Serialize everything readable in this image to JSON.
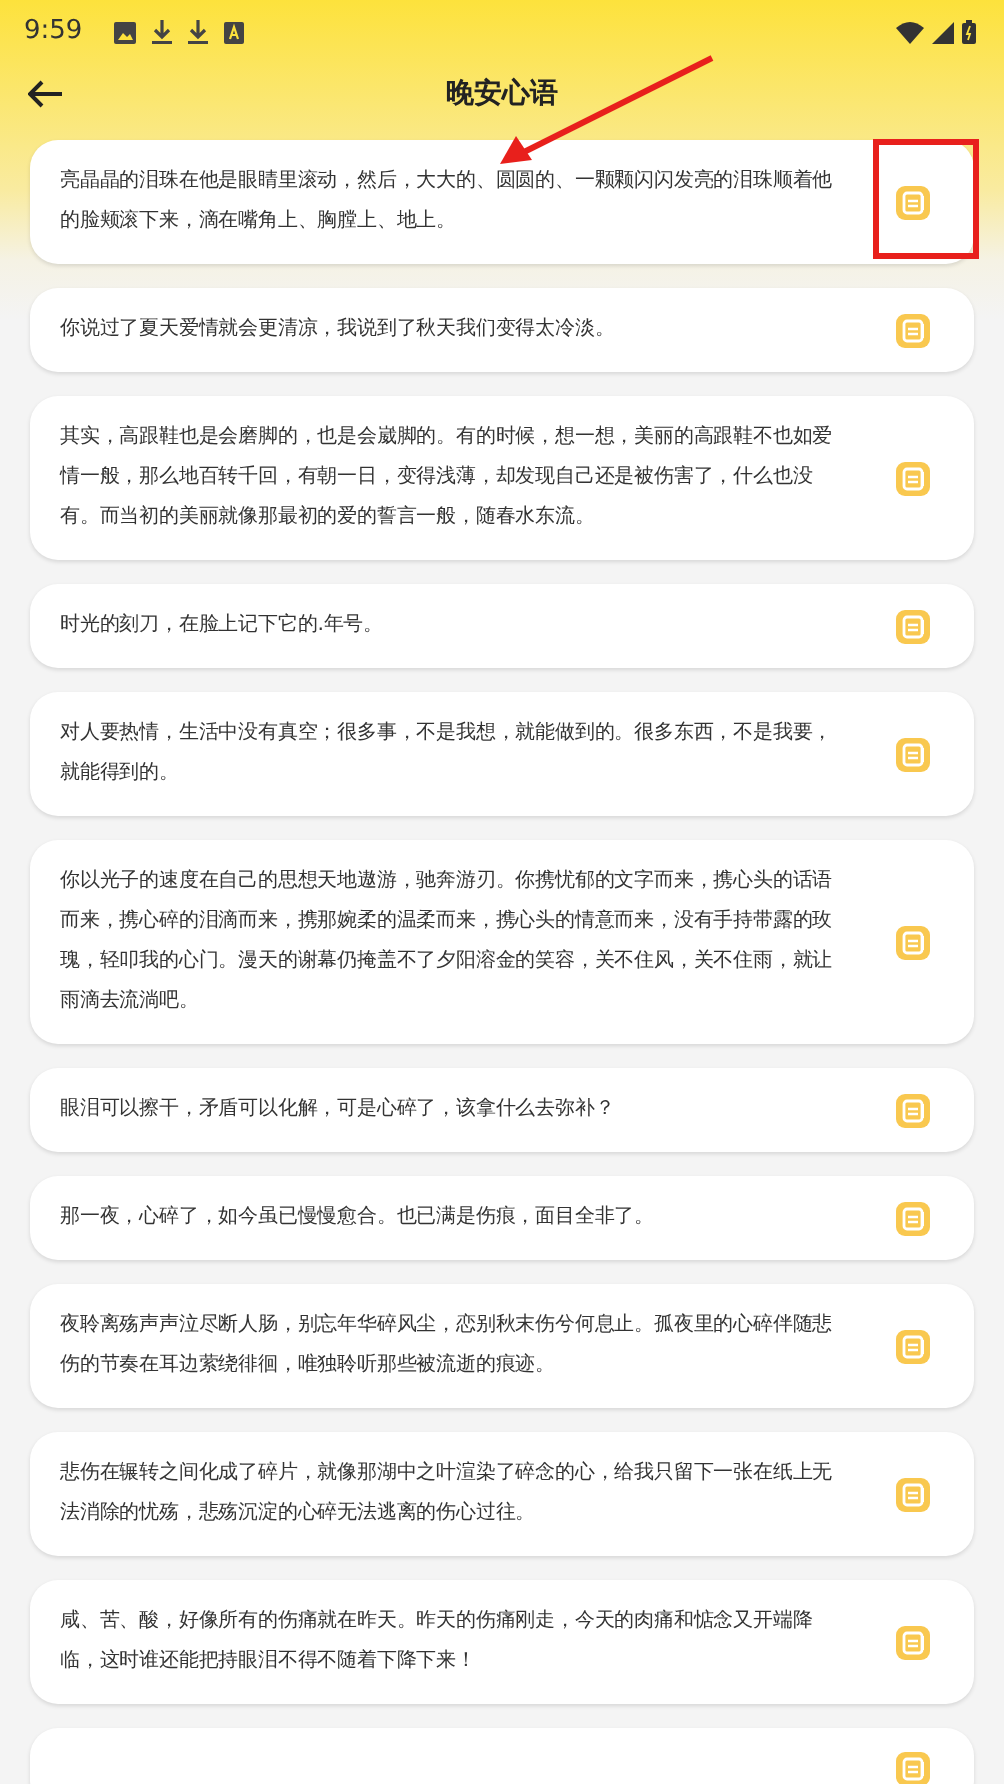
{
  "status_bar": {
    "time": "9:59"
  },
  "app_bar": {
    "title": "晚安心语"
  },
  "items": [
    {
      "kind": "quote",
      "text": "亮晶晶的泪珠在他是眼睛里滚动，然后，大大的、圆圆的、一颗颗闪闪发亮的泪珠顺着他的脸颊滚下来，滴在嘴角上、胸膛上、地上。"
    },
    {
      "kind": "quote",
      "text": "你说过了夏天爱情就会更清凉，我说到了秋天我们变得太冷淡。"
    },
    {
      "kind": "quote",
      "text": "其实，高跟鞋也是会磨脚的，也是会崴脚的。有的时候，想一想，美丽的高跟鞋不也如爱情一般，那么地百转千回，有朝一日，变得浅薄，却发现自己还是被伤害了，什么也没有。而当初的美丽就像那最初的爱的誓言一般，随春水东流。"
    },
    {
      "kind": "quote",
      "text": "时光的刻刀，在脸上记下它的.年号。"
    },
    {
      "kind": "quote",
      "text": "对人要热情，生活中没有真空；很多事，不是我想，就能做到的。很多东西，不是我要，就能得到的。"
    },
    {
      "kind": "quote",
      "text": "你以光子的速度在自己的思想天地遨游，驰奔游刃。你携忧郁的文字而来，携心头的话语而来，携心碎的泪滴而来，携那婉柔的温柔而来，携心头的情意而来，没有手持带露的玫瑰，轻叩我的心门。漫天的谢幕仍掩盖不了夕阳溶金的笑容，关不住风，关不住雨，就让雨滴去流淌吧。"
    },
    {
      "kind": "quote",
      "text": "眼泪可以擦干，矛盾可以化解，可是心碎了，该拿什么去弥补？"
    },
    {
      "kind": "quote",
      "text": "那一夜，心碎了，如今虽已慢慢愈合。也已满是伤痕，面目全非了。"
    },
    {
      "kind": "quote",
      "text": "夜聆离殇声声泣尽断人肠，别忘年华碎风尘，恋别秋末伤兮何息止。孤夜里的心碎伴随悲伤的节奏在耳边萦绕徘徊，唯独聆听那些被流逝的痕迹。"
    },
    {
      "kind": "quote",
      "text": "悲伤在辗转之间化成了碎片，就像那湖中之叶渲染了碎念的心，给我只留下一张在纸上无法消除的忧殇，悲殇沉淀的心碎无法逃离的伤心过往。"
    },
    {
      "kind": "quote",
      "text": "咸、苦、酸，好像所有的伤痛就在昨天。昨天的伤痛刚走，今天的肉痛和惦念又开端降临，这时谁还能把持眼泪不得不随着下降下来！"
    },
    {
      "kind": "cut"
    }
  ],
  "annotations": {
    "arrow": true,
    "frame": true
  }
}
